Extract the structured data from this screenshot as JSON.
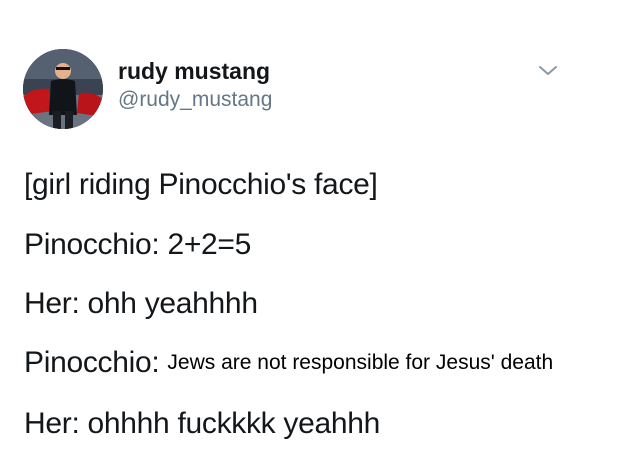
{
  "user": {
    "display_name": "rudy mustang",
    "handle": "@rudy_mustang"
  },
  "menu": {
    "icon": "chevron-down-icon"
  },
  "tweet": {
    "lines": [
      "[girl riding Pinocchio's face]",
      "Pinocchio: 2+2=5",
      "Her: ohh yeahhhh",
      "Pinocchio:",
      "Her: ohhhh fuckkkk yeahhh"
    ],
    "overlay_text": "Jews are not responsible for Jesus' death"
  },
  "colors": {
    "text": "#14171a",
    "muted": "#657786",
    "overlay_text": "#000000"
  }
}
